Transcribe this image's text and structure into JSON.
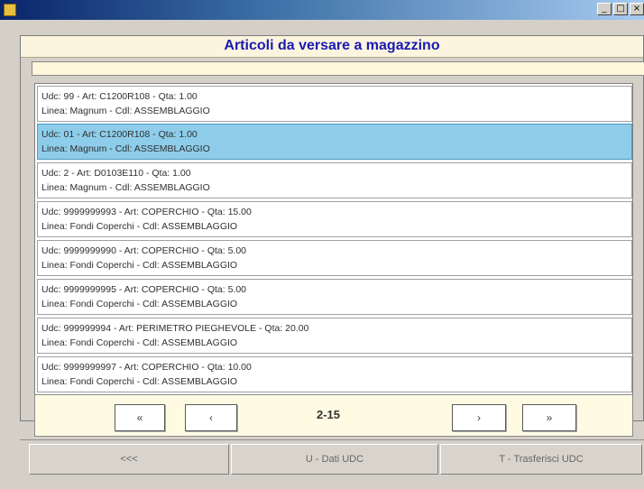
{
  "window": {
    "buttons": [
      "_",
      "□",
      "×"
    ]
  },
  "header": {
    "title": "Articoli da versare a magazzino"
  },
  "list": {
    "items": [
      {
        "line1": "Udc: 99 - Art: C1200R108 - Qta: 1.00",
        "line2": "Linea: Magnum - Cdl: ASSEMBLAGGIO",
        "selected": false
      },
      {
        "line1": "Udc: 01 - Art: C1200R108 - Qta: 1.00",
        "line2": "Linea: Magnum - Cdl: ASSEMBLAGGIO",
        "selected": true
      },
      {
        "line1": "Udc: 2 - Art: D0103E110 - Qta: 1.00",
        "line2": "Linea: Magnum - Cdl: ASSEMBLAGGIO",
        "selected": false
      },
      {
        "line1": "Udc: 9999999993 - Art: COPERCHIO - Qta: 15.00",
        "line2": "Linea: Fondi Coperchi - Cdl: ASSEMBLAGGIO",
        "selected": false
      },
      {
        "line1": "Udc: 9999999990 - Art: COPERCHIO - Qta: 5.00",
        "line2": "Linea: Fondi Coperchi - Cdl: ASSEMBLAGGIO",
        "selected": false
      },
      {
        "line1": "Udc: 9999999995 - Art: COPERCHIO - Qta: 5.00",
        "line2": "Linea: Fondi Coperchi - Cdl: ASSEMBLAGGIO",
        "selected": false
      },
      {
        "line1": "Udc: 999999994 - Art: PERIMETRO PIEGHEVOLE - Qta: 20.00",
        "line2": "Linea: Fondi Coperchi - Cdl: ASSEMBLAGGIO",
        "selected": false
      },
      {
        "line1": "Udc: 9999999997 - Art: COPERCHIO - Qta: 10.00",
        "line2": "Linea: Fondi Coperchi - Cdl: ASSEMBLAGGIO",
        "selected": false
      }
    ]
  },
  "pager": {
    "first_label": "«",
    "prev_label": "‹",
    "page_label": "2-15",
    "next_label": "›",
    "last_label": "»"
  },
  "actions": {
    "back_label": "<<<",
    "dati_udc_label": "U - Dati UDC",
    "trasferisci_udc_label": "T - Trasferisci UDC"
  },
  "colors": {
    "title_text": "#1a1ab0",
    "selected_row": "#8dcdea",
    "pager_bg": "#fffbe3"
  }
}
